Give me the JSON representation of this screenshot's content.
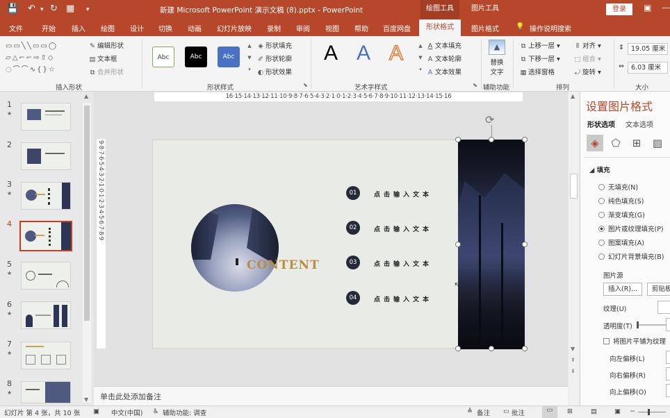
{
  "window": {
    "title": "新建 Microsoft PowerPoint 演示文稿 (8).pptx  -  PowerPoint",
    "context_tabs": [
      "绘图工具",
      "图片工具"
    ],
    "login_label": "登录",
    "undo_icon": "undo-icon",
    "redo_icon": "redo-icon"
  },
  "tabs": [
    "文件",
    "开始",
    "插入",
    "绘图",
    "设计",
    "切换",
    "动画",
    "幻灯片放映",
    "录制",
    "审阅",
    "视图",
    "帮助",
    "百度网盘",
    "形状格式",
    "图片格式"
  ],
  "active_tab": "形状格式",
  "tell_me": "操作说明搜索",
  "ribbon": {
    "insert_shapes": {
      "label": "插入形状",
      "edit_shape": "编辑形状",
      "text_box": "文本框",
      "merge_shapes": "合并形状"
    },
    "shape_styles": {
      "label": "形状样式",
      "swatches": [
        "Abc",
        "Abc",
        "Abc"
      ],
      "fill": "形状填充",
      "outline": "形状轮廓",
      "effects": "形状效果"
    },
    "wordart": {
      "label": "艺术字样式",
      "letters": [
        "A",
        "A",
        "A"
      ],
      "text_fill": "文本填充",
      "text_outline": "文本轮廓",
      "text_effects": "文本效果"
    },
    "accessibility": {
      "label": "辅助功能",
      "alt_text_line1": "替换",
      "alt_text_line2": "文字"
    },
    "arrange": {
      "label": "排列",
      "bring_forward": "上移一层",
      "send_backward": "下移一层",
      "selection_pane": "选择窗格",
      "align": "对齐",
      "group": "组合",
      "rotate": "旋转"
    },
    "size": {
      "label": "大小",
      "height": "19.05 厘米",
      "width": "6.03 厘米"
    }
  },
  "slides": [
    {
      "num": "1"
    },
    {
      "num": "2"
    },
    {
      "num": "3"
    },
    {
      "num": "4"
    },
    {
      "num": "5"
    },
    {
      "num": "6"
    },
    {
      "num": "7"
    },
    {
      "num": "8"
    }
  ],
  "selected_slide": "4",
  "ruler": {
    "horizontal": "16·15·14·13·12·11·10·9·8·7·6·5·4·3·2·1·0·1·2·3·4·5·6·7·8·9·10·11·12·13·14·15·16",
    "vertical": "9·8·7·6·5·4·3·2·1·0·1·2·3·4·5·6·7·8·9"
  },
  "slide_content": {
    "word": "CONTENT",
    "items": [
      {
        "num": "01",
        "text": "点击输入文本"
      },
      {
        "num": "02",
        "text": "点击输入文本"
      },
      {
        "num": "03",
        "text": "点击输入文本"
      },
      {
        "num": "04",
        "text": "点击输入文本"
      }
    ]
  },
  "notes_placeholder": "单击此处添加备注",
  "format_pane": {
    "title": "设置图片格式",
    "tabs": [
      "形状选项",
      "文本选项"
    ],
    "icons": [
      "fill-line-icon",
      "effects-icon",
      "size-properties-icon",
      "picture-icon"
    ],
    "section": "填充",
    "fill_options": [
      {
        "label": "无填充(N)",
        "selected": false
      },
      {
        "label": "纯色填充(S)",
        "selected": false
      },
      {
        "label": "渐变填充(G)",
        "selected": false
      },
      {
        "label": "图片或纹理填充(P)",
        "selected": true
      },
      {
        "label": "图案填充(A)",
        "selected": false
      },
      {
        "label": "幻灯片背景填充(B)",
        "selected": false
      }
    ],
    "picture_source": "图片源",
    "insert_button": "插入(R)...",
    "clipboard_button": "剪贴板",
    "texture": "纹理(U)",
    "transparency": "透明度(T)",
    "tile_checkbox": "将图片平铺为纹理",
    "offset_left": "向左偏移(L)",
    "offset_right": "向右偏移(R)",
    "offset_up": "向上偏移(O)"
  },
  "status": {
    "slide_info": "幻灯片 第 4 张，共 10 张",
    "language": "中文(中国)",
    "accessibility": "辅助功能: 调查",
    "notes": "备注",
    "comments": "批注"
  },
  "colors": {
    "brand": "#b7472a",
    "content_gold": "#b98d3f",
    "selected_border": "#c43e1c"
  }
}
